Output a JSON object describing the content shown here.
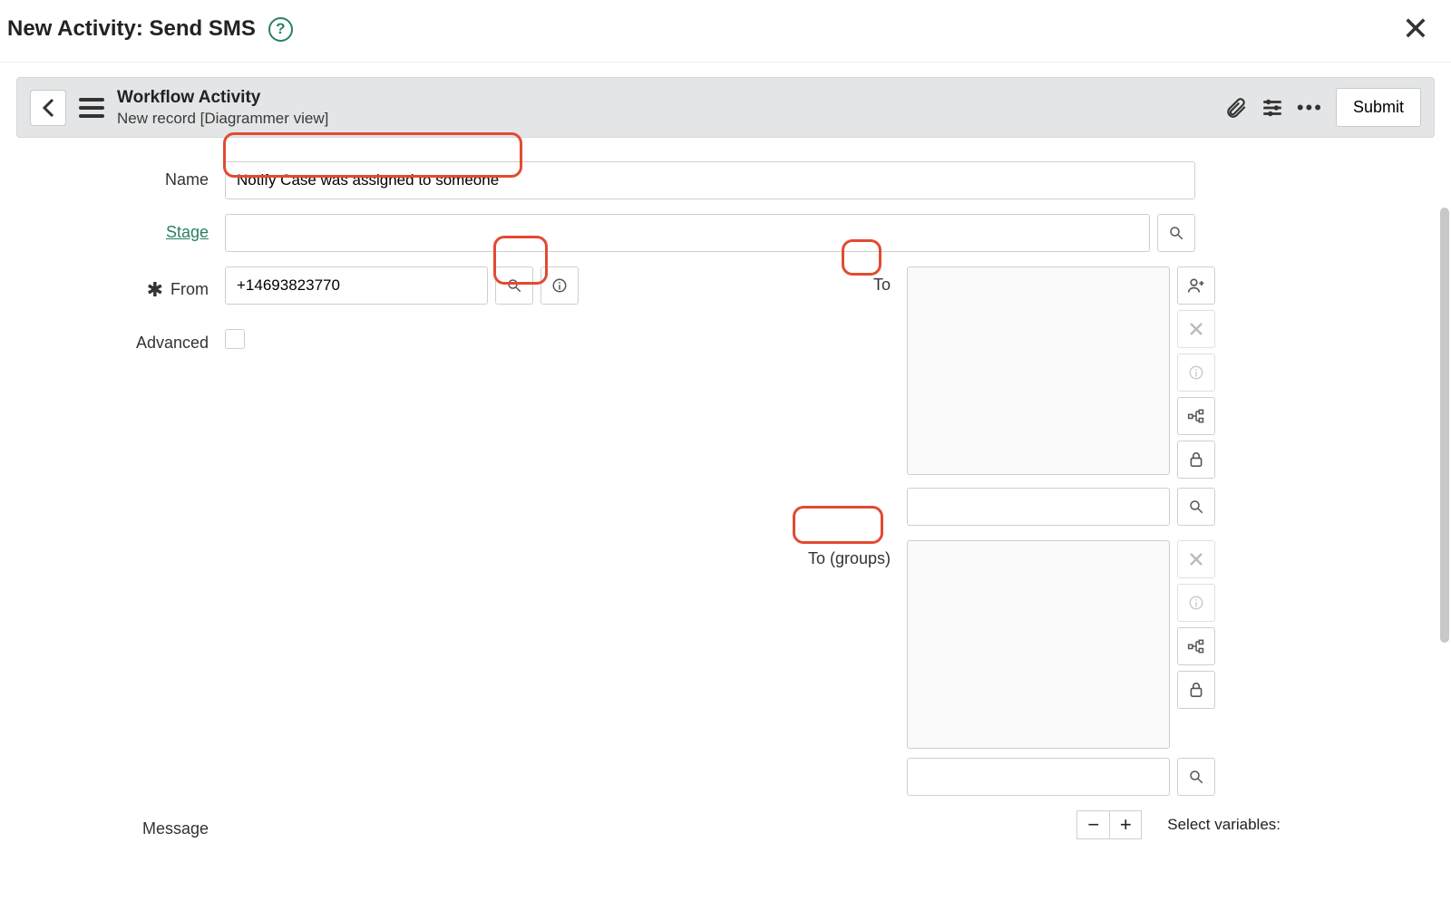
{
  "dialog": {
    "title": "New Activity: Send SMS"
  },
  "recordBar": {
    "title": "Workflow Activity",
    "subtitle": "New record [Diagrammer view]",
    "submit": "Submit"
  },
  "form": {
    "name": {
      "label": "Name",
      "value": "Notify Case was assigned to someone"
    },
    "stage": {
      "label": "Stage",
      "value": ""
    },
    "from": {
      "label": "From",
      "value": "+14693823770"
    },
    "advanced": {
      "label": "Advanced"
    },
    "to": {
      "label": "To"
    },
    "toGroups": {
      "label": "To (groups)"
    },
    "message": {
      "label": "Message",
      "selectVars": "Select variables:"
    }
  }
}
